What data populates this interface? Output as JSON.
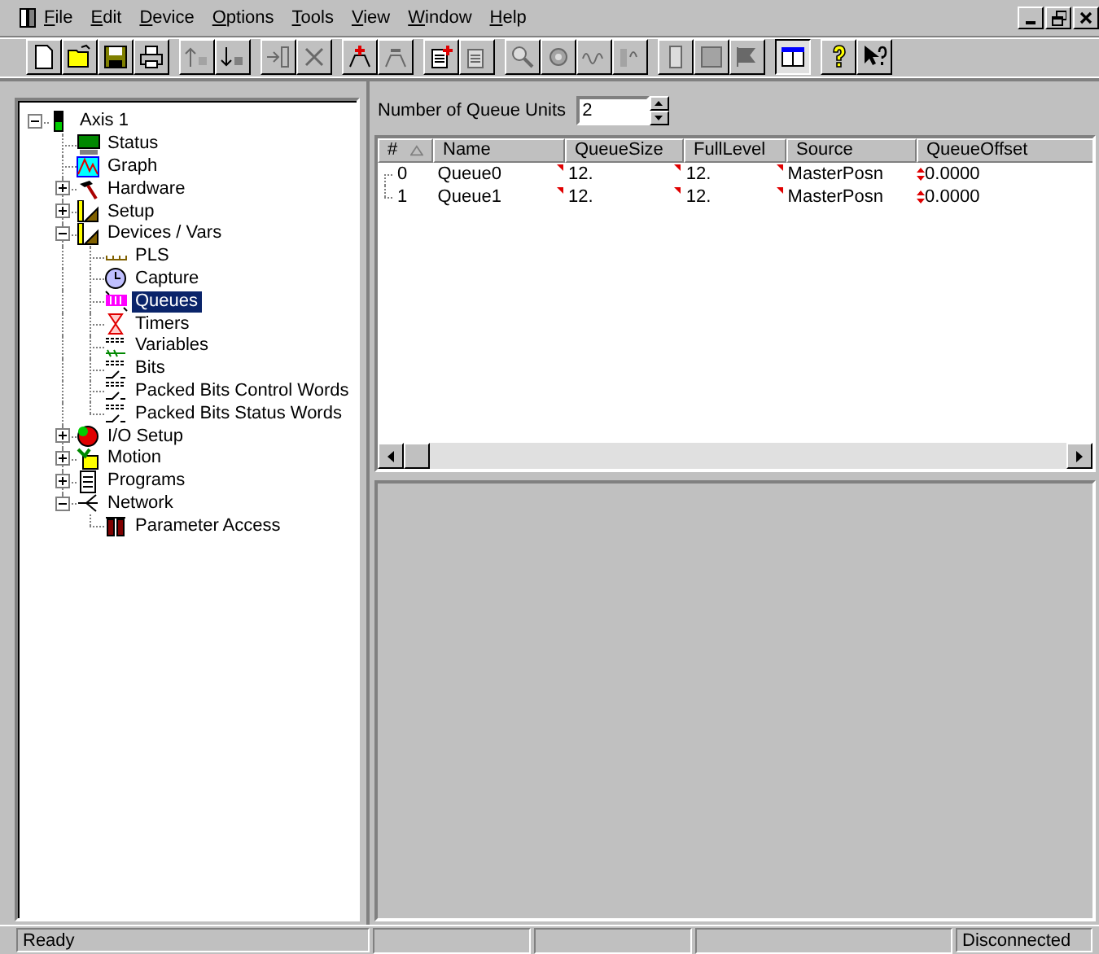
{
  "menu": [
    "File",
    "Edit",
    "Device",
    "Options",
    "Tools",
    "View",
    "Window",
    "Help"
  ],
  "toolbar": [
    [
      {
        "disabled": false,
        "pressed": false
      },
      {
        "disabled": false,
        "pressed": false
      },
      {
        "disabled": false,
        "pressed": false
      },
      {
        "disabled": false,
        "pressed": false
      }
    ],
    [
      {
        "disabled": true,
        "pressed": false
      },
      {
        "disabled": false,
        "pressed": false
      }
    ],
    [
      {
        "disabled": true,
        "pressed": false
      },
      {
        "disabled": true,
        "pressed": false
      }
    ],
    [
      {
        "disabled": false,
        "pressed": false
      },
      {
        "disabled": true,
        "pressed": false
      }
    ],
    [
      {
        "disabled": false,
        "pressed": false
      },
      {
        "disabled": true,
        "pressed": false
      }
    ],
    [
      {
        "disabled": true,
        "pressed": false
      },
      {
        "disabled": true,
        "pressed": false
      },
      {
        "disabled": true,
        "pressed": false
      },
      {
        "disabled": true,
        "pressed": false
      }
    ],
    [
      {
        "disabled": true,
        "pressed": false
      },
      {
        "disabled": true,
        "pressed": false
      },
      {
        "disabled": true,
        "pressed": false
      }
    ],
    [
      {
        "disabled": false,
        "pressed": true
      }
    ],
    [
      {
        "disabled": false,
        "pressed": false
      },
      {
        "disabled": false,
        "pressed": false
      }
    ]
  ],
  "tree": [
    {
      "label": "Axis 1",
      "selected": false,
      "expanded": true,
      "children": [
        {
          "label": "Status",
          "selected": false
        },
        {
          "label": "Graph",
          "selected": false
        },
        {
          "label": "Hardware",
          "selected": false,
          "expanded": false
        },
        {
          "label": "Setup",
          "selected": false,
          "expanded": false
        },
        {
          "label": "Devices / Vars",
          "selected": false,
          "expanded": true,
          "children": [
            {
              "label": "PLS",
              "selected": false
            },
            {
              "label": "Capture",
              "selected": false
            },
            {
              "label": "Queues",
              "selected": true
            },
            {
              "label": "Timers",
              "selected": false
            },
            {
              "label": "Variables",
              "selected": false
            },
            {
              "label": "Bits",
              "selected": false
            },
            {
              "label": "Packed Bits Control Words",
              "selected": false
            },
            {
              "label": "Packed Bits Status Words",
              "selected": false
            }
          ]
        },
        {
          "label": "I/O Setup",
          "selected": false,
          "expanded": false
        },
        {
          "label": "Motion",
          "selected": false,
          "expanded": false
        },
        {
          "label": "Programs",
          "selected": false,
          "expanded": false
        },
        {
          "label": "Network",
          "selected": false,
          "expanded": true,
          "children": [
            {
              "label": "Parameter Access",
              "selected": false
            }
          ]
        }
      ]
    }
  ],
  "queue_units": {
    "label": "Number of Queue Units",
    "value": "2"
  },
  "table": {
    "columns": [
      "#",
      "Name",
      "QueueSize",
      "FullLevel",
      "Source",
      "QueueOffset"
    ],
    "rows": [
      [
        "0",
        "Queue0",
        "12.",
        "12.",
        "MasterPosn",
        "0.0000"
      ],
      [
        "1",
        "Queue1",
        "12.",
        "12.",
        "MasterPosn",
        "0.0000"
      ]
    ]
  },
  "status_bar": {
    "message": "Ready",
    "connection": "Disconnected"
  }
}
